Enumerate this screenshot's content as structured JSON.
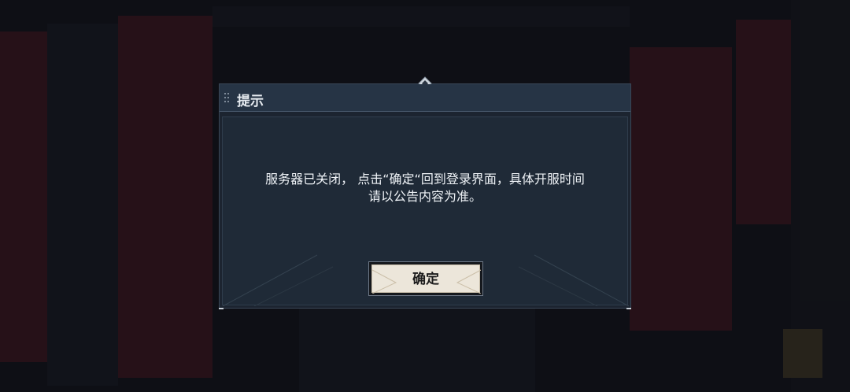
{
  "dialog": {
    "title": "提示",
    "message_line1": "服务器已关闭， 点击“确定“回到登录界面，具体开服时间",
    "message_line2": "请以公告内容为准。",
    "confirm_label": "确定"
  },
  "colors": {
    "dialog_bg": "#1c2430",
    "header_bg": "#263445",
    "button_face": "#ece6da",
    "text": "#eef2f6",
    "background_accent": "#4a1a22"
  },
  "icons": {
    "header_grip": "grip-icon",
    "top_ornament": "diamond-ornament-icon"
  }
}
